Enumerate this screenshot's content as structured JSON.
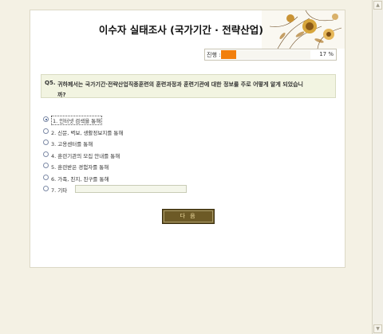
{
  "survey": {
    "title": "이수자 실태조사 (국가기간 · 전략산업)"
  },
  "progress": {
    "label": "진행 :",
    "percent_text": "17 %",
    "value": 0.17,
    "fill_color": "#f27f0c"
  },
  "question": {
    "number": "Q5.",
    "text": "귀하께서는 국가기간·전략산업직종훈련의 훈련과정과 훈련기관에 대한 정보를 주로 어떻게 알게 되었습니까?"
  },
  "options": [
    {
      "label": "1. 인터넷 검색을 통해",
      "selected": true
    },
    {
      "label": "2. 신문, 벽보, 생활정보지를 통해",
      "selected": false
    },
    {
      "label": "3. 고용센터를 통해",
      "selected": false
    },
    {
      "label": "4. 훈련기관의 모집 안내를 통해",
      "selected": false
    },
    {
      "label": "5. 훈련받은 경험자를 통해",
      "selected": false
    },
    {
      "label": "6. 가족, 친지, 친구를 통해",
      "selected": false
    },
    {
      "label": "7. 기타",
      "selected": false
    }
  ],
  "other_input_value": "",
  "next_button": "다 음",
  "icons": {
    "header_art": "flower-illustration",
    "scroll_up": "scroll-up-arrow-icon",
    "scroll_down": "scroll-down-arrow-icon"
  },
  "colors": {
    "background": "#f4f1e4",
    "accent": "#6d5a26",
    "question_bg": "#f2f4e1"
  }
}
